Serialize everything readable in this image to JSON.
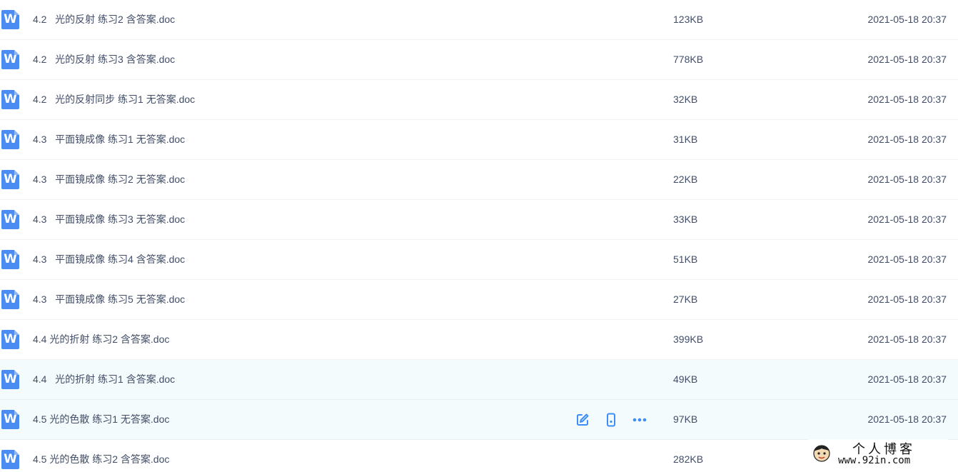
{
  "files": [
    {
      "name": "4.2   光的反射 练习2 含答案.doc",
      "size": "123KB",
      "date": "2021-05-18 20:37",
      "icon": "word-doc-icon"
    },
    {
      "name": "4.2   光的反射 练习3 含答案.doc",
      "size": "778KB",
      "date": "2021-05-18 20:37",
      "icon": "word-doc-icon"
    },
    {
      "name": "4.2   光的反射同步 练习1 无答案.doc",
      "size": "32KB",
      "date": "2021-05-18 20:37",
      "icon": "word-doc-icon"
    },
    {
      "name": "4.3   平面镜成像 练习1 无答案.doc",
      "size": "31KB",
      "date": "2021-05-18 20:37",
      "icon": "word-doc-icon"
    },
    {
      "name": "4.3   平面镜成像 练习2 无答案.doc",
      "size": "22KB",
      "date": "2021-05-18 20:37",
      "icon": "word-doc-icon"
    },
    {
      "name": "4.3   平面镜成像 练习3 无答案.doc",
      "size": "33KB",
      "date": "2021-05-18 20:37",
      "icon": "word-doc-icon"
    },
    {
      "name": "4.3   平面镜成像 练习4 含答案.doc",
      "size": "51KB",
      "date": "2021-05-18 20:37",
      "icon": "word-doc-icon"
    },
    {
      "name": "4.3   平面镜成像 练习5 无答案.doc",
      "size": "27KB",
      "date": "2021-05-18 20:37",
      "icon": "word-doc-icon"
    },
    {
      "name": "4.4 光的折射 练习2 含答案.doc",
      "size": "399KB",
      "date": "2021-05-18 20:37",
      "icon": "word-doc-icon"
    },
    {
      "name": "4.4   光的折射 练习1 含答案.doc",
      "size": "49KB",
      "date": "2021-05-18 20:37",
      "icon": "word-doc-icon"
    },
    {
      "name": "4.5 光的色散 练习1 无答案.doc",
      "size": "97KB",
      "date": "2021-05-18 20:37",
      "icon": "word-doc-icon"
    },
    {
      "name": "4.5 光的色散 练习2 含答案.doc",
      "size": "282KB",
      "date": "",
      "icon": "word-doc-icon"
    }
  ],
  "icon_letter": "W",
  "hover_actions": [
    {
      "name": "edit-icon"
    },
    {
      "name": "phone-icon"
    },
    {
      "name": "more-icon"
    }
  ],
  "colors": {
    "accent": "#3f8ef7",
    "text": "#424e67",
    "hover_row": "#f4fbfd"
  },
  "watermark": {
    "title": "个人博客",
    "url": "www.92in.com"
  }
}
